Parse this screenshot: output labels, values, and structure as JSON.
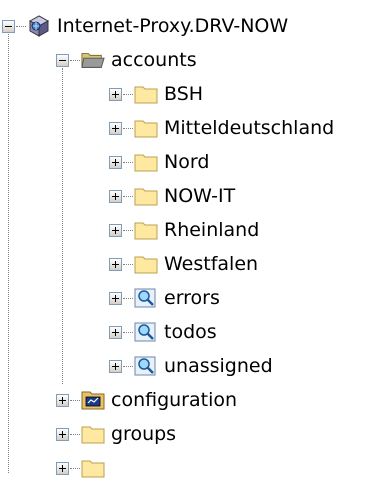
{
  "tree": {
    "root": {
      "label": "Internet-Proxy.DRV-NOW",
      "icon": "server-globe-icon",
      "expanded": true
    },
    "accounts": {
      "label": "accounts",
      "icon": "open-folder-icon",
      "expanded": true
    },
    "accounts_children": [
      {
        "label": "BSH",
        "icon": "folder-icon"
      },
      {
        "label": "Mitteldeutschland",
        "icon": "folder-icon"
      },
      {
        "label": "Nord",
        "icon": "folder-icon"
      },
      {
        "label": "NOW-IT",
        "icon": "folder-icon"
      },
      {
        "label": "Rheinland",
        "icon": "folder-icon"
      },
      {
        "label": "Westfalen",
        "icon": "folder-icon"
      },
      {
        "label": "errors",
        "icon": "search-folder-icon"
      },
      {
        "label": "todos",
        "icon": "search-folder-icon"
      },
      {
        "label": "unassigned",
        "icon": "search-folder-icon"
      }
    ],
    "configuration": {
      "label": "configuration",
      "icon": "config-folder-icon"
    },
    "groups": {
      "label": "groups",
      "icon": "folder-icon"
    }
  }
}
